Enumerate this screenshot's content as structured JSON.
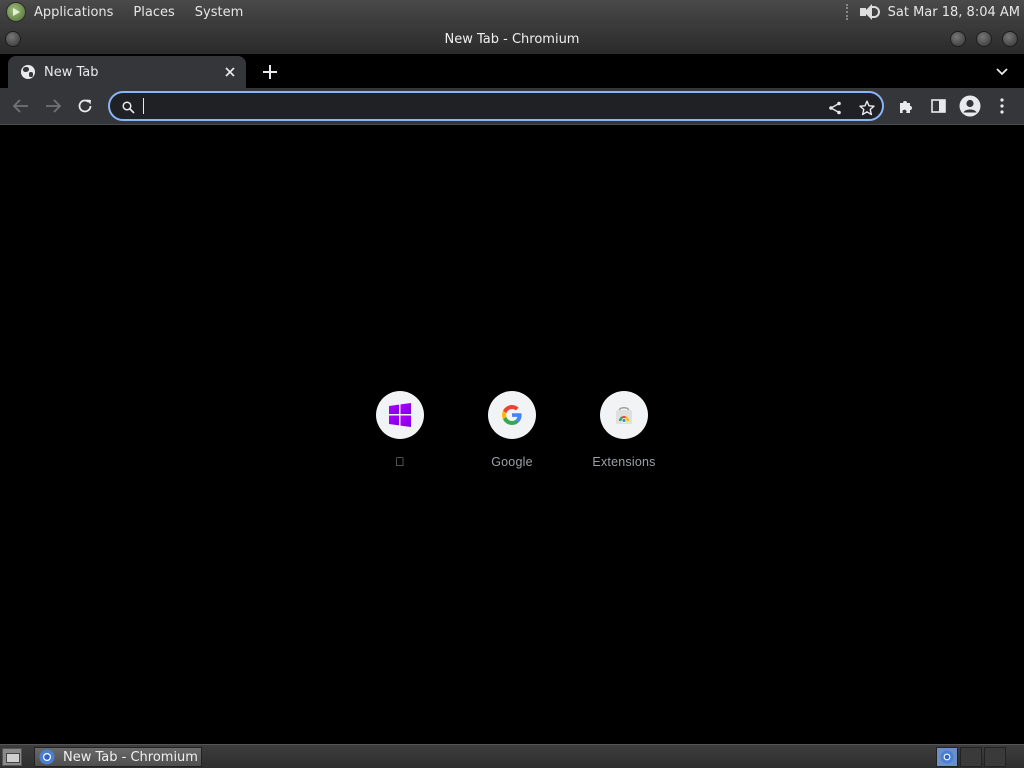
{
  "top_panel": {
    "menus": [
      "Applications",
      "Places",
      "System"
    ],
    "clock": "Sat Mar 18,  8:04 AM"
  },
  "window": {
    "title": "New Tab - Chromium"
  },
  "tab": {
    "title": "New Tab",
    "close_icon": "close-icon"
  },
  "omnibox": {
    "value": "",
    "placeholder": ""
  },
  "shortcuts": [
    {
      "label": "\u0000",
      "icon": "windows-logo-icon"
    },
    {
      "label": "Google",
      "icon": "google-g-icon"
    },
    {
      "label": "Extensions",
      "icon": "chrome-web-store-icon"
    }
  ],
  "taskbar": {
    "item_label": "New Tab - Chromium"
  },
  "colors": {
    "accent": "#8ab4f8",
    "toolbar": "#35363a",
    "content_bg": "#000000",
    "shortcut_label": "#9aa0a6"
  }
}
